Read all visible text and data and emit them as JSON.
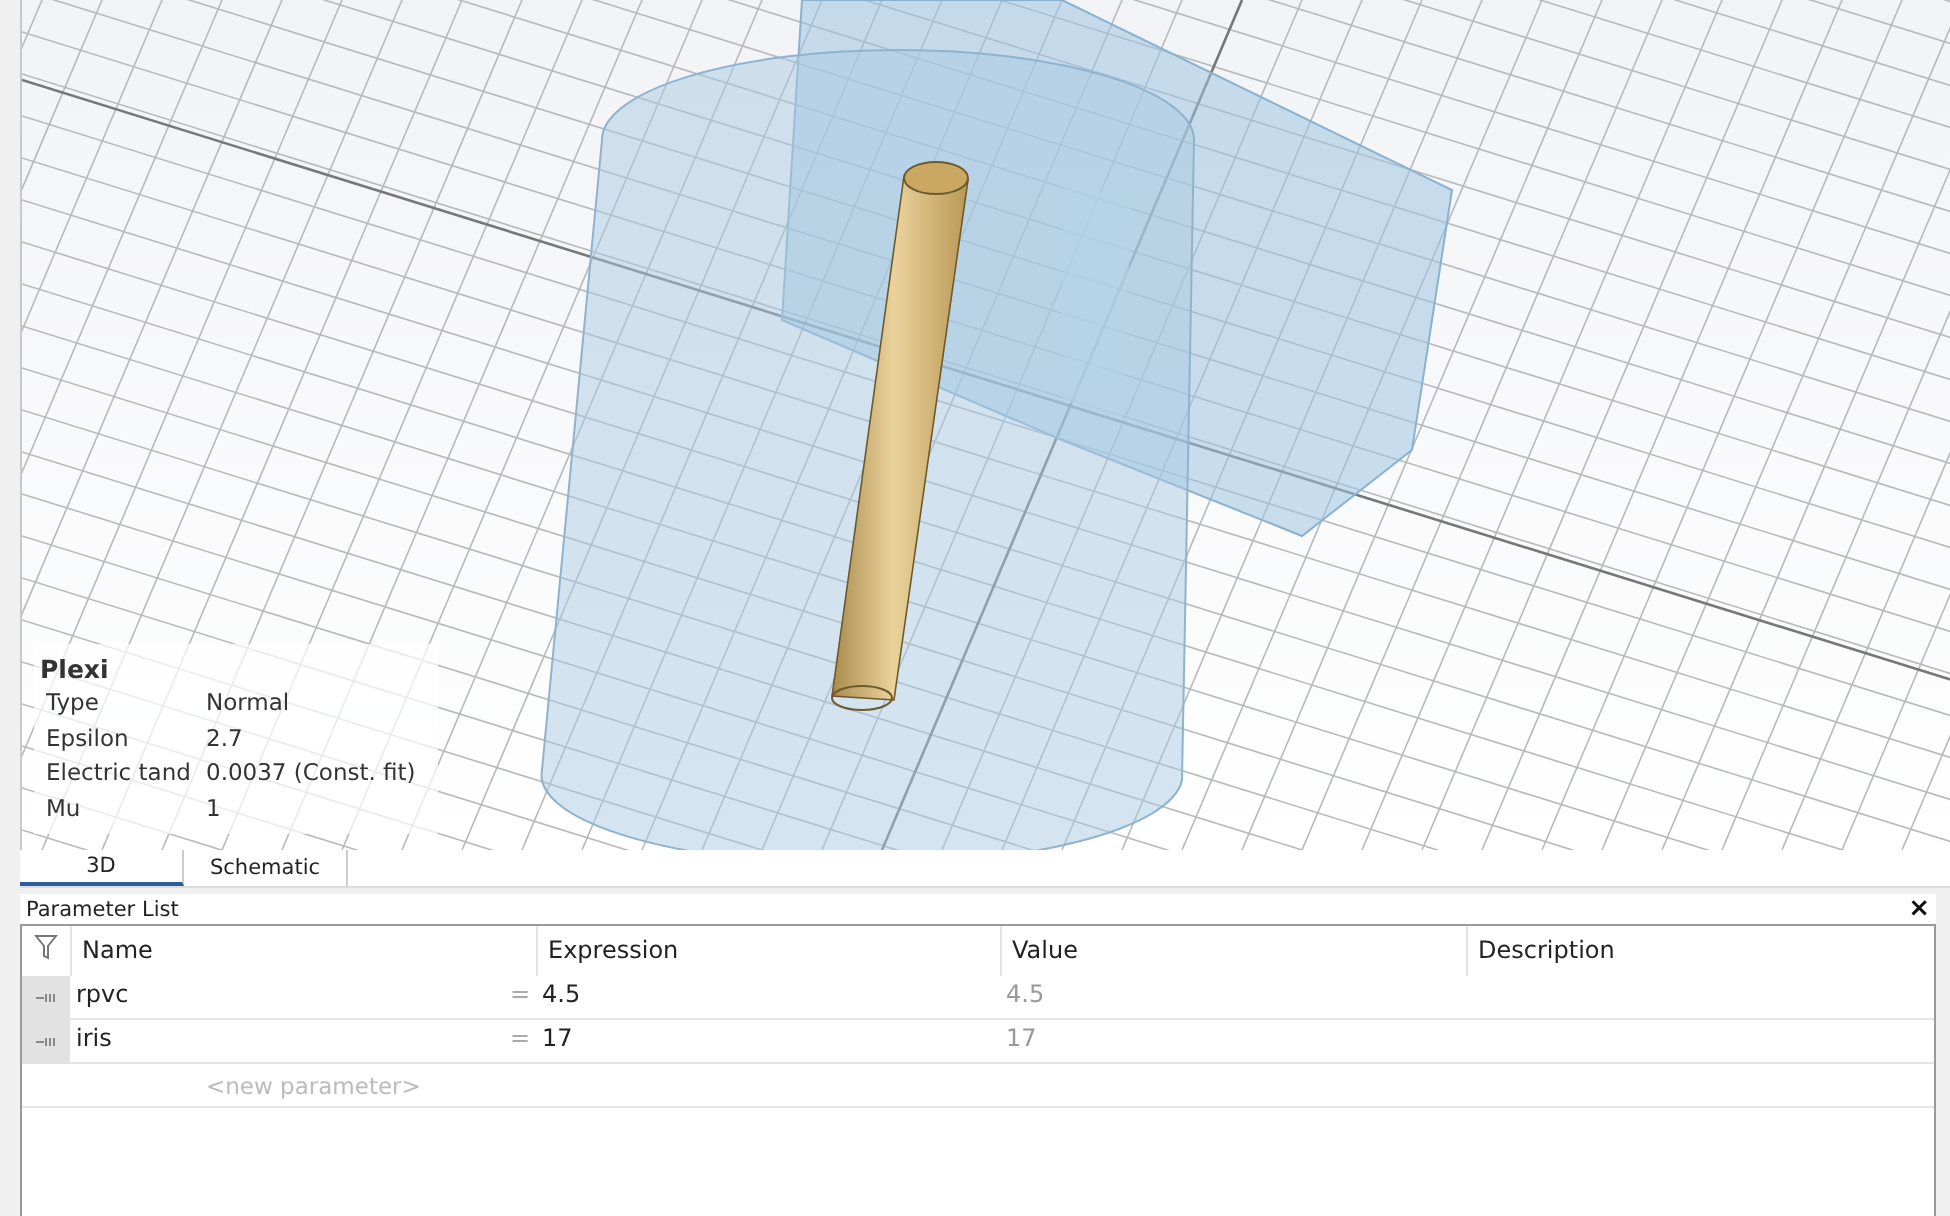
{
  "material": {
    "name": "Plexi",
    "properties": [
      {
        "label": "Type",
        "value": "Normal"
      },
      {
        "label": "Epsilon",
        "value": "2.7"
      },
      {
        "label": "Electric tand",
        "value": "0.0037 (Const. fit)"
      },
      {
        "label": "Mu",
        "value": "1"
      }
    ]
  },
  "view_tabs": [
    {
      "label": "3D",
      "selected": true
    },
    {
      "label": "Schematic",
      "selected": false
    }
  ],
  "parameter_list": {
    "title": "Parameter List",
    "close": "×",
    "columns": [
      "Name",
      "Expression",
      "Value",
      "Description"
    ],
    "rows": [
      {
        "name": "rpvc",
        "operator": "=",
        "expression": "4.5",
        "value": "4.5"
      },
      {
        "name": "iris",
        "operator": "=",
        "expression": "17",
        "value": "17"
      }
    ],
    "new_row_hint": "<new parameter>"
  }
}
